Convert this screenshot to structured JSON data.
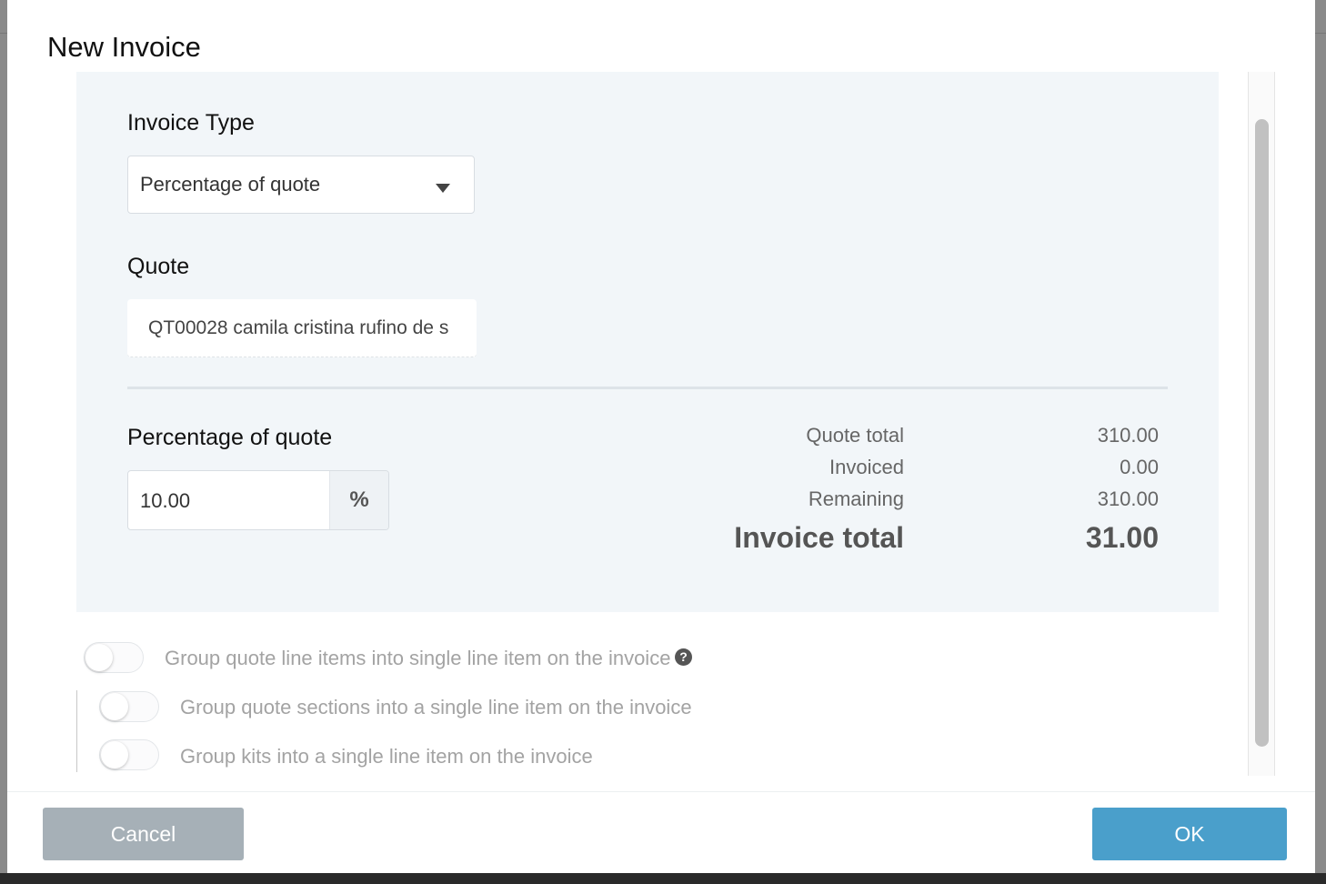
{
  "dialog": {
    "title": "New Invoice"
  },
  "invoice_type": {
    "label": "Invoice Type",
    "selected": "Percentage of quote"
  },
  "quote": {
    "label": "Quote",
    "value": "QT00028 camila cristina rufino de s"
  },
  "percentage": {
    "label": "Percentage of quote",
    "value": "10.00",
    "unit": "%"
  },
  "summary": {
    "rows": [
      {
        "label": "Quote total",
        "value": "310.00"
      },
      {
        "label": "Invoiced",
        "value": "0.00"
      },
      {
        "label": "Remaining",
        "value": "310.00"
      }
    ],
    "total_label": "Invoice total",
    "total_value": "31.00"
  },
  "options": [
    {
      "label": "Group quote line items into single line item on the invoice",
      "enabled": false
    },
    {
      "label": "Group quote sections into a single line item on the invoice",
      "enabled": false
    },
    {
      "label": "Group kits into a single line item on the invoice",
      "enabled": false
    }
  ],
  "footer": {
    "cancel_label": "Cancel",
    "ok_label": "OK"
  },
  "colors": {
    "primary": "#4a9fcb",
    "secondary": "#a6b0b7",
    "panel_bg": "#f2f6f9"
  },
  "icons": {
    "dropdown": "caret-down-icon",
    "help": "question-circle-icon"
  }
}
